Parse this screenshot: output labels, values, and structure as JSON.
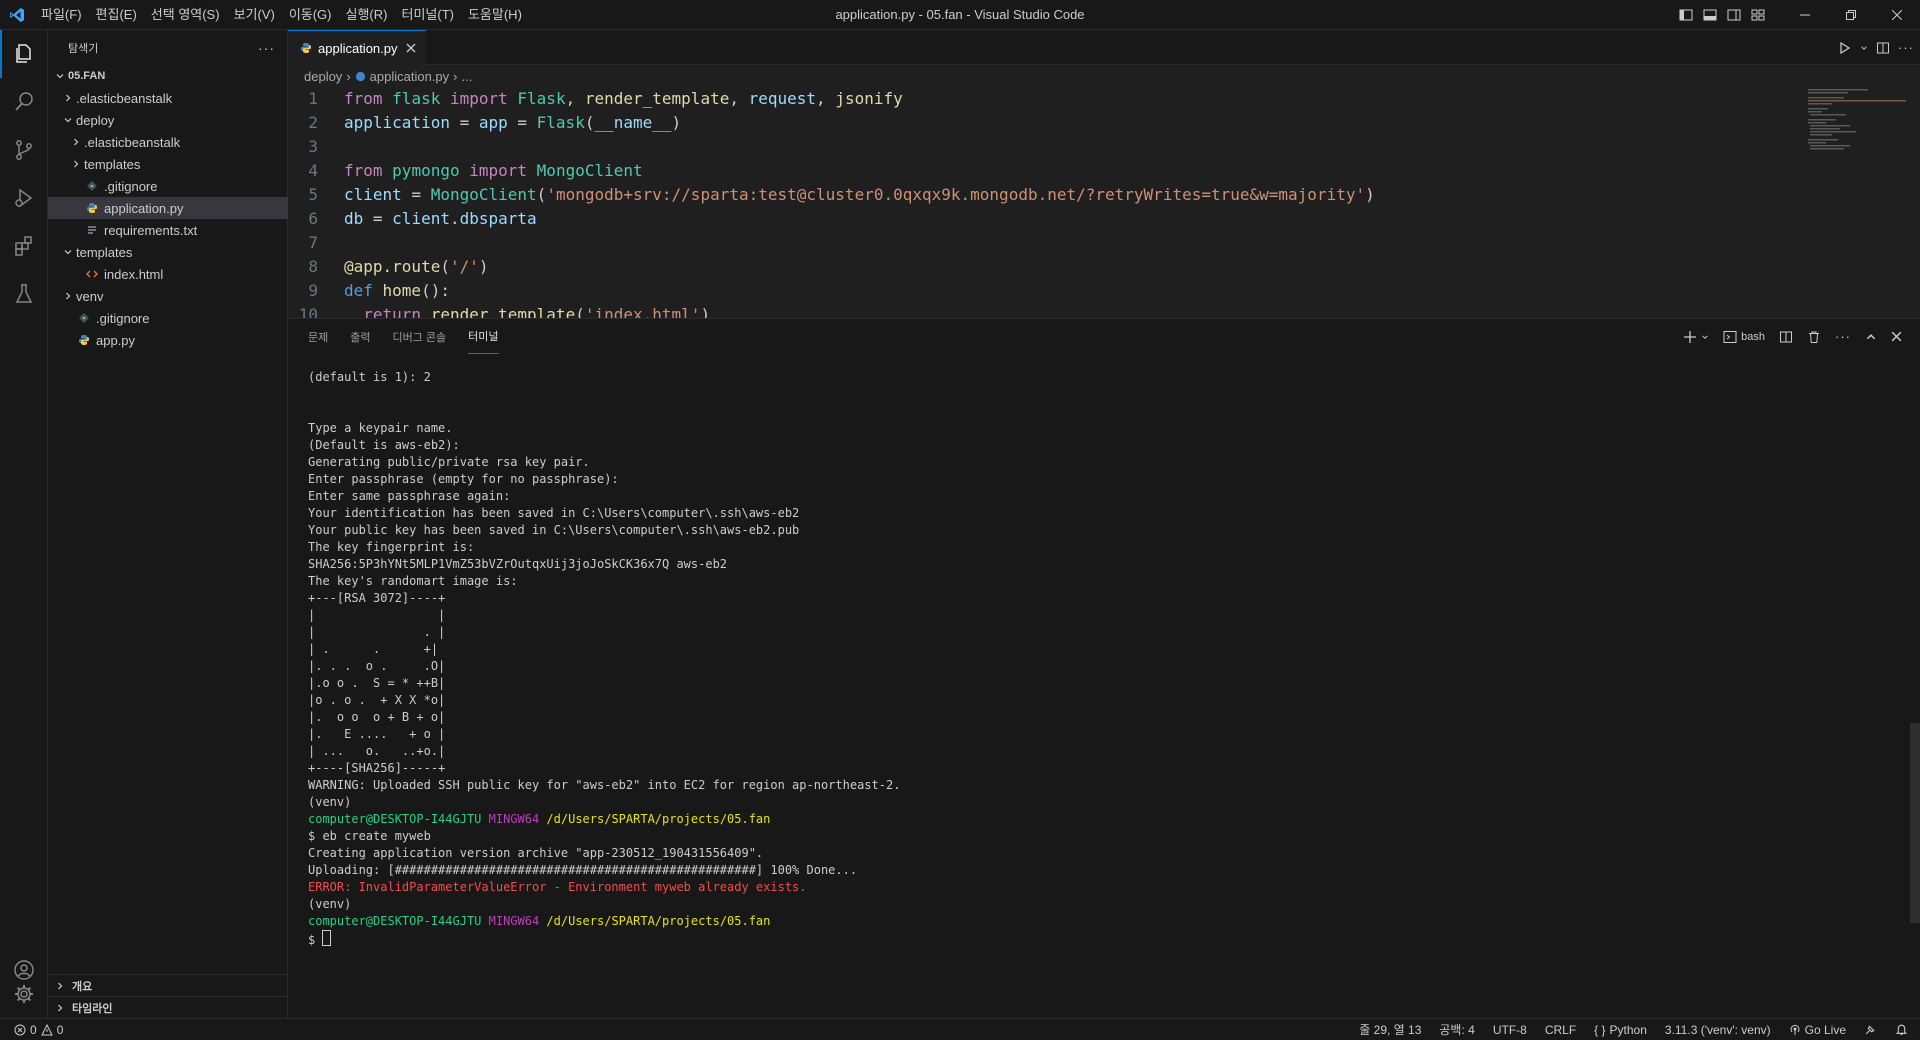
{
  "window": {
    "title": "application.py - 05.fan - Visual Studio Code",
    "menu": [
      "파일(F)",
      "편집(E)",
      "선택 영역(S)",
      "보기(V)",
      "이동(G)",
      "실행(R)",
      "터미널(T)",
      "도움말(H)"
    ]
  },
  "sidebar": {
    "title": "탐색기",
    "root": "05.FAN",
    "tree": [
      {
        "label": ".elasticbeanstalk",
        "type": "folder",
        "open": false,
        "depth": 1
      },
      {
        "label": "deploy",
        "type": "folder",
        "open": true,
        "depth": 1
      },
      {
        "label": ".elasticbeanstalk",
        "type": "folder",
        "open": false,
        "depth": 2
      },
      {
        "label": "templates",
        "type": "folder",
        "open": false,
        "depth": 2
      },
      {
        "label": ".gitignore",
        "type": "gitignore",
        "depth": 2
      },
      {
        "label": "application.py",
        "type": "python",
        "depth": 2,
        "selected": true
      },
      {
        "label": "requirements.txt",
        "type": "text",
        "depth": 2
      },
      {
        "label": "templates",
        "type": "folder",
        "open": true,
        "depth": 1
      },
      {
        "label": "index.html",
        "type": "html",
        "depth": 2
      },
      {
        "label": "venv",
        "type": "folder",
        "open": false,
        "depth": 1
      },
      {
        "label": ".gitignore",
        "type": "gitignore",
        "depth": 1
      },
      {
        "label": "app.py",
        "type": "python",
        "depth": 1
      }
    ],
    "outline_label": "개요",
    "timeline_label": "타임라인"
  },
  "editor": {
    "tab_label": "application.py",
    "breadcrumb": [
      "deploy",
      "application.py",
      "..."
    ],
    "code_lines": [
      [
        [
          "kw",
          "from "
        ],
        [
          "cls",
          "flask "
        ],
        [
          "kw",
          "import "
        ],
        [
          "cls",
          "Flask"
        ],
        [
          "plain",
          ", "
        ],
        [
          "fn",
          "render_template"
        ],
        [
          "plain",
          ", "
        ],
        [
          "var",
          "request"
        ],
        [
          "plain",
          ", "
        ],
        [
          "fn",
          "jsonify"
        ]
      ],
      [
        [
          "var",
          "application "
        ],
        [
          "plain",
          "= "
        ],
        [
          "var",
          "app "
        ],
        [
          "plain",
          "= "
        ],
        [
          "cls",
          "Flask"
        ],
        [
          "plain",
          "("
        ],
        [
          "var",
          "__name__"
        ],
        [
          "plain",
          ")"
        ]
      ],
      [],
      [
        [
          "kw",
          "from "
        ],
        [
          "cls",
          "pymongo "
        ],
        [
          "kw",
          "import "
        ],
        [
          "cls",
          "MongoClient"
        ]
      ],
      [
        [
          "var",
          "client "
        ],
        [
          "plain",
          "= "
        ],
        [
          "cls",
          "MongoClient"
        ],
        [
          "plain",
          "("
        ],
        [
          "str",
          "'mongodb+srv://sparta:test@cluster0.0qxqx9k.mongodb.net/?retryWrites=true&w=majority'"
        ],
        [
          "plain",
          ")"
        ]
      ],
      [
        [
          "var",
          "db "
        ],
        [
          "plain",
          "= "
        ],
        [
          "var",
          "client"
        ],
        [
          "plain",
          "."
        ],
        [
          "var",
          "dbsparta"
        ]
      ],
      [],
      [
        [
          "fn",
          "@app.route"
        ],
        [
          "plain",
          "("
        ],
        [
          "str",
          "'/'"
        ],
        [
          "plain",
          ")"
        ]
      ],
      [
        [
          "kw2",
          "def "
        ],
        [
          "fn",
          "home"
        ],
        [
          "plain",
          "():"
        ]
      ],
      [
        [
          "plain",
          "  "
        ],
        [
          "kw",
          "return "
        ],
        [
          "fn",
          "render_template"
        ],
        [
          "plain",
          "("
        ],
        [
          "str",
          "'index.html'"
        ],
        [
          "plain",
          ")"
        ]
      ]
    ]
  },
  "panel": {
    "tabs": [
      "문제",
      "출력",
      "디버그 콘솔",
      "터미널"
    ],
    "active_tab": "터미널",
    "shell_label": "bash",
    "terminal_lines": [
      [
        [
          "n",
          "(default is 1): 2"
        ]
      ],
      [],
      [],
      [
        [
          "n",
          "Type a keypair name."
        ]
      ],
      [
        [
          "n",
          "(Default is aws-eb2):"
        ]
      ],
      [
        [
          "n",
          "Generating public/private rsa key pair."
        ]
      ],
      [
        [
          "n",
          "Enter passphrase (empty for no passphrase):"
        ]
      ],
      [
        [
          "n",
          "Enter same passphrase again:"
        ]
      ],
      [
        [
          "n",
          "Your identification has been saved in C:\\Users\\computer\\.ssh\\aws-eb2"
        ]
      ],
      [
        [
          "n",
          "Your public key has been saved in C:\\Users\\computer\\.ssh\\aws-eb2.pub"
        ]
      ],
      [
        [
          "n",
          "The key fingerprint is:"
        ]
      ],
      [
        [
          "n",
          "SHA256:5P3hYNt5MLP1VmZ53bVZrOutqxUij3joJoSkCK36x7Q aws-eb2"
        ]
      ],
      [
        [
          "n",
          "The key's randomart image is:"
        ]
      ],
      [
        [
          "n",
          "+---[RSA 3072]----+"
        ]
      ],
      [
        [
          "n",
          "|                 |"
        ]
      ],
      [
        [
          "n",
          "|               . |"
        ]
      ],
      [
        [
          "n",
          "| .      .      +|"
        ]
      ],
      [
        [
          "n",
          "|. . .  o .     .O|"
        ]
      ],
      [
        [
          "n",
          "|.o o .  S = * ++B|"
        ]
      ],
      [
        [
          "n",
          "|o . o .  + X X *o|"
        ]
      ],
      [
        [
          "n",
          "|.  o o  o + B + o|"
        ]
      ],
      [
        [
          "n",
          "|.   E ....   + o |"
        ]
      ],
      [
        [
          "n",
          "| ...   o.   ..+o.|"
        ]
      ],
      [
        [
          "n",
          "+----[SHA256]-----+"
        ]
      ],
      [
        [
          "n",
          "WARNING: Uploaded SSH public key for \"aws-eb2\" into EC2 for region ap-northeast-2."
        ]
      ],
      [
        [
          "n",
          "(venv)"
        ]
      ],
      [
        [
          "g",
          "computer@DESKTOP-I44GJTU "
        ],
        [
          "m",
          "MINGW64 "
        ],
        [
          "y",
          "/d/Users/SPARTA/projects/05.fan"
        ]
      ],
      [
        [
          "n",
          "$ eb create myweb"
        ]
      ],
      [
        [
          "n",
          "Creating application version archive \"app-230512_190431556409\"."
        ]
      ],
      [
        [
          "n",
          "Uploading: [##################################################] 100% Done..."
        ]
      ],
      [
        [
          "r",
          "ERROR: InvalidParameterValueError - Environment myweb already exists."
        ]
      ],
      [
        [
          "n",
          "(venv)"
        ]
      ],
      [
        [
          "g",
          "computer@DESKTOP-I44GJTU "
        ],
        [
          "m",
          "MINGW64 "
        ],
        [
          "y",
          "/d/Users/SPARTA/projects/05.fan"
        ]
      ],
      [
        [
          "n",
          "$ "
        ],
        [
          "cursor",
          ""
        ]
      ]
    ]
  },
  "statusbar": {
    "errors": "0",
    "warnings": "0",
    "position": "줄 29, 열 13",
    "spaces": "공백: 4",
    "encoding": "UTF-8",
    "eol": "CRLF",
    "language": "Python",
    "interpreter": "3.11.3 ('venv': venv)",
    "golive": "Go Live"
  },
  "colors": {
    "accent": "#0078d4",
    "background": "#1f1f1f",
    "sidebar": "#181818"
  }
}
